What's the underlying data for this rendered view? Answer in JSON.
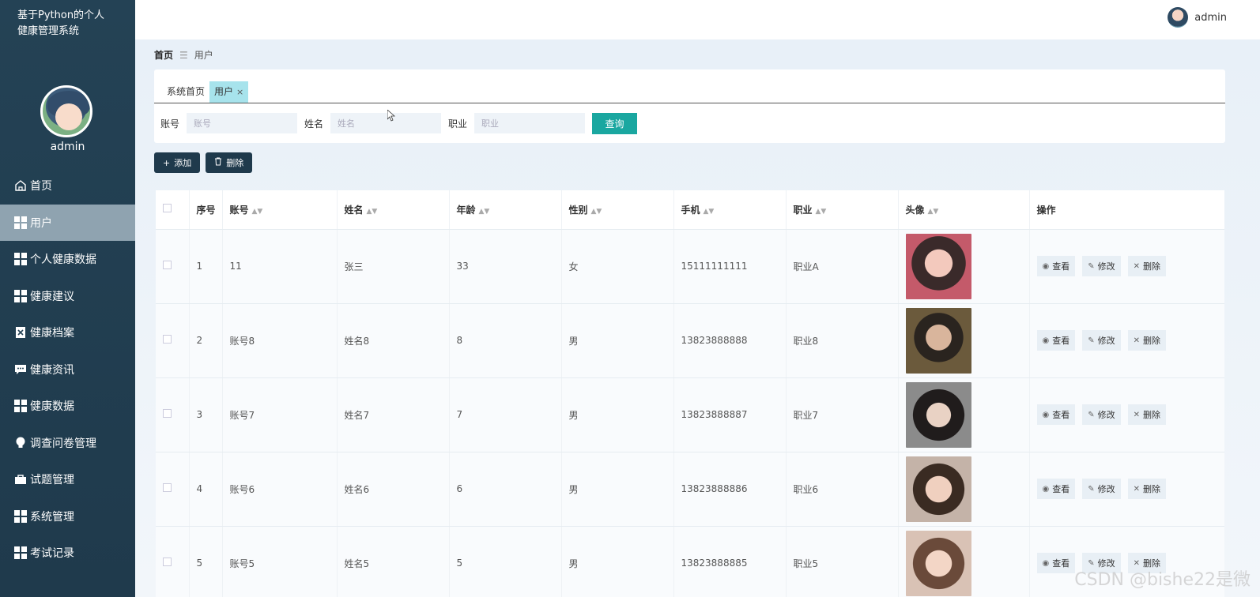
{
  "app": {
    "title_line1": "基于Python的个人",
    "title_line2": "健康管理系统"
  },
  "sidebar": {
    "admin_name": "admin",
    "items": [
      {
        "label": "首页",
        "icon": "home-icon"
      },
      {
        "label": "用户",
        "icon": "grid-icon",
        "active": true
      },
      {
        "label": "个人健康数据",
        "icon": "grid-icon"
      },
      {
        "label": "健康建议",
        "icon": "grid-icon"
      },
      {
        "label": "健康档案",
        "icon": "file-x-icon"
      },
      {
        "label": "健康资讯",
        "icon": "chat-icon"
      },
      {
        "label": "健康数据",
        "icon": "grid-icon"
      },
      {
        "label": "调查问卷管理",
        "icon": "bulb-icon"
      },
      {
        "label": "试题管理",
        "icon": "briefcase-icon"
      },
      {
        "label": "系统管理",
        "icon": "grid-icon"
      },
      {
        "label": "考试记录",
        "icon": "grid-icon"
      }
    ]
  },
  "topbar": {
    "user": "admin"
  },
  "breadcrumb": {
    "home": "首页",
    "current": "用户"
  },
  "tabs": [
    {
      "label": "系统首页"
    },
    {
      "label": "用户",
      "close": "×"
    }
  ],
  "search": {
    "account_label": "账号",
    "account_placeholder": "账号",
    "name_label": "姓名",
    "name_placeholder": "姓名",
    "job_label": "职业",
    "job_placeholder": "职业",
    "button": "查询"
  },
  "actions": {
    "add": "添加",
    "delete": "删除"
  },
  "table": {
    "headers": {
      "index": "序号",
      "account": "账号",
      "name": "姓名",
      "age": "年龄",
      "gender": "性别",
      "phone": "手机",
      "job": "职业",
      "avatar": "头像",
      "ops": "操作"
    },
    "rows": [
      {
        "index": "1",
        "account": "11",
        "name": "张三",
        "age": "33",
        "gender": "女",
        "phone": "15111111111",
        "job": "职业A"
      },
      {
        "index": "2",
        "account": "账号8",
        "name": "姓名8",
        "age": "8",
        "gender": "男",
        "phone": "13823888888",
        "job": "职业8"
      },
      {
        "index": "3",
        "account": "账号7",
        "name": "姓名7",
        "age": "7",
        "gender": "男",
        "phone": "13823888887",
        "job": "职业7"
      },
      {
        "index": "4",
        "account": "账号6",
        "name": "姓名6",
        "age": "6",
        "gender": "男",
        "phone": "13823888886",
        "job": "职业6"
      },
      {
        "index": "5",
        "account": "账号5",
        "name": "姓名5",
        "age": "5",
        "gender": "男",
        "phone": "13823888885",
        "job": "职业5"
      }
    ],
    "op_view": "查看",
    "op_edit": "修改",
    "op_delete": "删除"
  },
  "watermark": "CSDN @bishe22是微"
}
